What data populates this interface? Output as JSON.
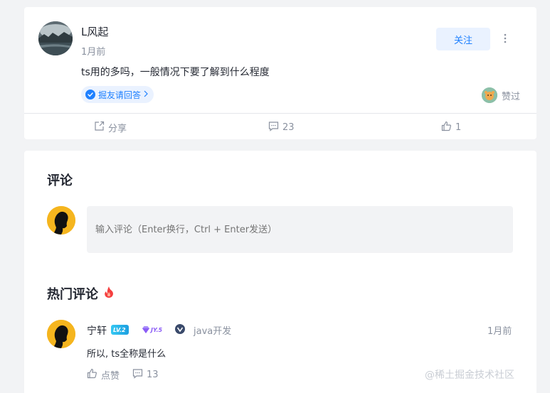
{
  "post": {
    "author_name": "L风起",
    "time": "1月前",
    "follow_label": "关注",
    "content": "ts用的多吗，一般情况下要了解到什么程度",
    "invite_label": "掘友请回答",
    "liked_label": "赞过",
    "actions": {
      "share_label": "分享",
      "comment_count": "23",
      "like_count": "1"
    }
  },
  "comments": {
    "title": "评论",
    "input_placeholder": "输入评论（Enter换行，Ctrl + Enter发送）",
    "hot_title": "热门评论",
    "items": [
      {
        "name": "宁轩",
        "level_badge": "LV.2",
        "jy_badge": "JY.5",
        "job_title": "java开发",
        "time": "1月前",
        "text": "所以, ts全称是什么",
        "like_label": "点赞",
        "reply_count": "13"
      }
    ]
  },
  "watermark": "@稀土掘金技术社区",
  "colors": {
    "accent": "#1e80ff",
    "accent_bg": "#eaf2ff",
    "muted_text": "#8a919f",
    "page_bg": "#f2f3f5",
    "avatar_yellow": "#f5b51e",
    "fire": "#f53f3f"
  },
  "icons": {
    "more": "more-vertical-icon",
    "share": "share-icon",
    "comment": "comment-icon",
    "like": "thumb-up-icon",
    "invite": "invite-icon",
    "fire": "fire-icon",
    "verify": "verify-icon"
  }
}
